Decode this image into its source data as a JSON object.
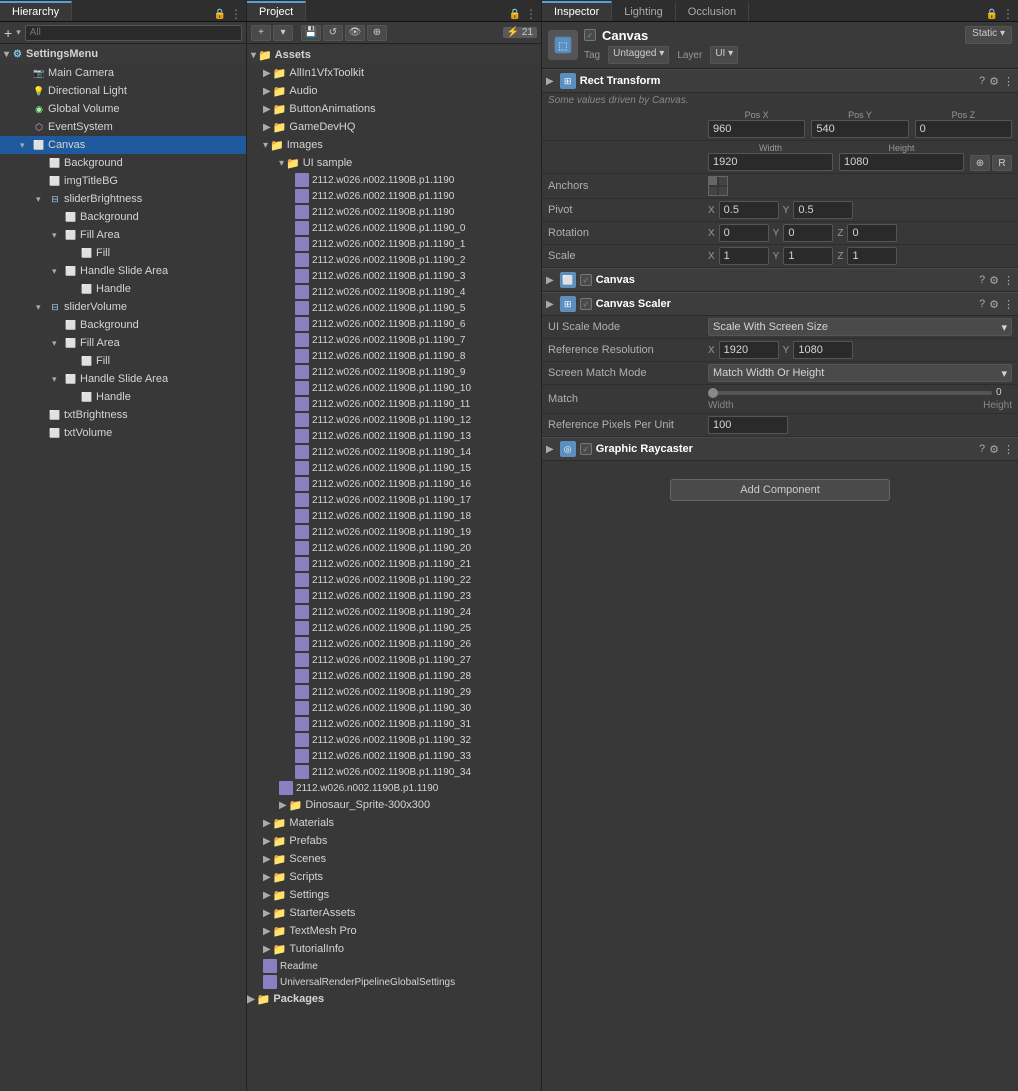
{
  "hierarchy": {
    "title": "Hierarchy",
    "search_placeholder": "All",
    "scene": "SettingsMenu",
    "items": [
      {
        "id": "main-camera",
        "label": "Main Camera",
        "indent": 1,
        "icon": "cam",
        "arrow": ""
      },
      {
        "id": "directional-light",
        "label": "Directional Light",
        "indent": 1,
        "icon": "light",
        "arrow": ""
      },
      {
        "id": "global-volume",
        "label": "Global Volume",
        "indent": 1,
        "icon": "vol",
        "arrow": ""
      },
      {
        "id": "event-system",
        "label": "EventSystem",
        "indent": 1,
        "icon": "evt",
        "arrow": ""
      },
      {
        "id": "canvas",
        "label": "Canvas",
        "indent": 1,
        "icon": "canvas",
        "arrow": "▾",
        "selected": true
      },
      {
        "id": "background",
        "label": "Background",
        "indent": 2,
        "icon": "bg",
        "arrow": ""
      },
      {
        "id": "imgtitlebg",
        "label": "imgTitleBG",
        "indent": 2,
        "icon": "bg",
        "arrow": ""
      },
      {
        "id": "sliderbrightness",
        "label": "sliderBrightness",
        "indent": 2,
        "icon": "slider",
        "arrow": "▾"
      },
      {
        "id": "background2",
        "label": "Background",
        "indent": 3,
        "icon": "bg",
        "arrow": ""
      },
      {
        "id": "fillarea",
        "label": "Fill Area",
        "indent": 3,
        "icon": "bg",
        "arrow": "▾"
      },
      {
        "id": "fill",
        "label": "Fill",
        "indent": 4,
        "icon": "bg",
        "arrow": ""
      },
      {
        "id": "handleslidearea",
        "label": "Handle Slide Area",
        "indent": 3,
        "icon": "bg",
        "arrow": "▾"
      },
      {
        "id": "handle",
        "label": "Handle",
        "indent": 4,
        "icon": "bg",
        "arrow": ""
      },
      {
        "id": "slidervolume",
        "label": "sliderVolume",
        "indent": 2,
        "icon": "slider",
        "arrow": "▾"
      },
      {
        "id": "background3",
        "label": "Background",
        "indent": 3,
        "icon": "bg",
        "arrow": ""
      },
      {
        "id": "fillarea2",
        "label": "Fill Area",
        "indent": 3,
        "icon": "bg",
        "arrow": "▾"
      },
      {
        "id": "fill2",
        "label": "Fill",
        "indent": 4,
        "icon": "bg",
        "arrow": ""
      },
      {
        "id": "handleslidearea2",
        "label": "Handle Slide Area",
        "indent": 3,
        "icon": "bg",
        "arrow": "▾"
      },
      {
        "id": "handle2",
        "label": "Handle",
        "indent": 4,
        "icon": "bg",
        "arrow": ""
      },
      {
        "id": "txtbrightness",
        "label": "txtBrightness",
        "indent": 2,
        "icon": "bg",
        "arrow": ""
      },
      {
        "id": "txtvolume",
        "label": "txtVolume",
        "indent": 2,
        "icon": "bg",
        "arrow": ""
      }
    ]
  },
  "project": {
    "title": "Project",
    "badge": "21",
    "assets_label": "Assets",
    "folders": [
      {
        "label": "AllIn1VfxToolkit",
        "indent": 1
      },
      {
        "label": "Audio",
        "indent": 1
      },
      {
        "label": "ButtonAnimations",
        "indent": 1
      },
      {
        "label": "GameDevHQ",
        "indent": 1
      },
      {
        "label": "Images",
        "indent": 1,
        "expanded": true
      },
      {
        "label": "UI sample",
        "indent": 2,
        "expanded": true
      }
    ],
    "files": [
      "2112.w026.n002.1190B.p1.1190",
      "2112.w026.n002.1190B.p1.1190",
      "2112.w026.n002.1190B.p1.1190",
      "2112.w026.n002.1190B.p1.1190_0",
      "2112.w026.n002.1190B.p1.1190_1",
      "2112.w026.n002.1190B.p1.1190_2",
      "2112.w026.n002.1190B.p1.1190_3",
      "2112.w026.n002.1190B.p1.1190_4",
      "2112.w026.n002.1190B.p1.1190_5",
      "2112.w026.n002.1190B.p1.1190_6",
      "2112.w026.n002.1190B.p1.1190_7",
      "2112.w026.n002.1190B.p1.1190_8",
      "2112.w026.n002.1190B.p1.1190_9",
      "2112.w026.n002.1190B.p1.1190_10",
      "2112.w026.n002.1190B.p1.1190_11",
      "2112.w026.n002.1190B.p1.1190_12",
      "2112.w026.n002.1190B.p1.1190_13",
      "2112.w026.n002.1190B.p1.1190_14",
      "2112.w026.n002.1190B.p1.1190_15",
      "2112.w026.n002.1190B.p1.1190_16",
      "2112.w026.n002.1190B.p1.1190_17",
      "2112.w026.n002.1190B.p1.1190_18",
      "2112.w026.n002.1190B.p1.1190_19",
      "2112.w026.n002.1190B.p1.1190_20",
      "2112.w026.n002.1190B.p1.1190_21",
      "2112.w026.n002.1190B.p1.1190_22",
      "2112.w026.n002.1190B.p1.1190_23",
      "2112.w026.n002.1190B.p1.1190_24",
      "2112.w026.n002.1190B.p1.1190_25",
      "2112.w026.n002.1190B.p1.1190_26",
      "2112.w026.n002.1190B.p1.1190_27",
      "2112.w026.n002.1190B.p1.1190_28",
      "2112.w026.n002.1190B.p1.1190_29",
      "2112.w026.n002.1190B.p1.1190_30",
      "2112.w026.n002.1190B.p1.1190_31",
      "2112.w026.n002.1190B.p1.1190_32",
      "2112.w026.n002.1190B.p1.1190_33",
      "2112.w026.n002.1190B.p1.1190_34"
    ],
    "other_folders": [
      {
        "label": "2112.w026.n002.1190B.p1.1190",
        "indent": 2
      },
      {
        "label": "Dinosaur_Sprite-300x300",
        "indent": 2
      },
      {
        "label": "Materials",
        "indent": 1
      },
      {
        "label": "Prefabs",
        "indent": 1
      },
      {
        "label": "Scenes",
        "indent": 1
      },
      {
        "label": "Scripts",
        "indent": 1
      },
      {
        "label": "Settings",
        "indent": 1
      },
      {
        "label": "StarterAssets",
        "indent": 1
      },
      {
        "label": "TextMesh Pro",
        "indent": 1
      },
      {
        "label": "TutorialInfo",
        "indent": 1
      },
      {
        "label": "Readme",
        "indent": 1
      },
      {
        "label": "UniversalRenderPipelineGlobalSettings",
        "indent": 1
      },
      {
        "label": "Packages",
        "indent": 0
      }
    ]
  },
  "inspector": {
    "title": "Inspector",
    "lighting_tab": "Lighting",
    "occlusion_tab": "Occlusion",
    "go_name": "Canvas",
    "tag_label": "Tag",
    "tag_value": "Untagged",
    "layer_label": "Layer",
    "layer_value": "UI",
    "static_label": "Static",
    "rect_transform": {
      "title": "Rect Transform",
      "note": "Some values driven by Canvas.",
      "pos_x_label": "Pos X",
      "pos_x": "960",
      "pos_y_label": "Pos Y",
      "pos_y": "540",
      "pos_z_label": "Pos Z",
      "pos_z": "0",
      "width_label": "Width",
      "width": "1920",
      "height_label": "Height",
      "height": "1080",
      "anchors_label": "Anchors",
      "pivot_label": "Pivot",
      "pivot_x": "0.5",
      "pivot_y": "0.5",
      "rotation_label": "Rotation",
      "rot_x": "0",
      "rot_y": "0",
      "rot_z": "0",
      "scale_label": "Scale",
      "scale_x": "1",
      "scale_y": "1",
      "scale_z": "1"
    },
    "canvas": {
      "title": "Canvas"
    },
    "canvas_scaler": {
      "title": "Canvas Scaler",
      "ui_scale_mode_label": "UI Scale Mode",
      "ui_scale_mode": "Scale With Screen Size",
      "ref_res_label": "Reference Resolution",
      "ref_res_x": "1920",
      "ref_res_y": "1080",
      "screen_match_label": "Screen Match Mode",
      "screen_match": "Match Width Or Height",
      "match_label": "Match",
      "match_value": "0",
      "width_label": "Width",
      "height_label": "Height",
      "ref_pixels_label": "Reference Pixels Per Unit",
      "ref_pixels": "100"
    },
    "graphic_raycaster": {
      "title": "Graphic Raycaster"
    },
    "add_component": "Add Component"
  }
}
